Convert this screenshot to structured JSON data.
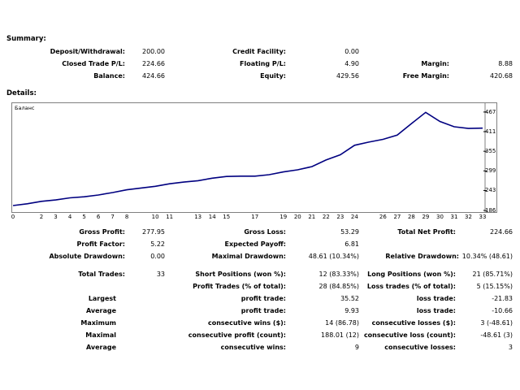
{
  "summary": {
    "title": "Summary:",
    "deposit_label": "Deposit/Withdrawal:",
    "deposit_value": "200.00",
    "credit_label": "Credit Facility:",
    "credit_value": "0.00",
    "closed_label": "Closed Trade P/L:",
    "closed_value": "224.66",
    "floating_label": "Floating P/L:",
    "floating_value": "4.90",
    "margin_label": "Margin:",
    "margin_value": "8.88",
    "balance_label": "Balance:",
    "balance_value": "424.66",
    "equity_label": "Equity:",
    "equity_value": "429.56",
    "free_margin_label": "Free Margin:",
    "free_margin_value": "420.68"
  },
  "details": {
    "title": "Details:"
  },
  "chart_data": {
    "type": "line",
    "title": "Баланс",
    "x": [
      0,
      1,
      2,
      3,
      4,
      5,
      6,
      7,
      8,
      9,
      10,
      11,
      12,
      13,
      14,
      15,
      16,
      17,
      18,
      19,
      20,
      21,
      22,
      23,
      24,
      25,
      26,
      27,
      28,
      29,
      30,
      31,
      32,
      33
    ],
    "y": [
      200,
      205,
      212,
      216,
      222,
      225,
      230,
      237,
      245,
      250,
      255,
      262,
      267,
      271,
      278,
      283,
      284,
      284,
      288,
      296,
      302,
      311,
      330,
      345,
      372,
      381,
      389,
      401,
      434,
      466,
      440,
      425,
      420,
      421
    ],
    "xticks": [
      0,
      2,
      3,
      4,
      5,
      6,
      7,
      8,
      10,
      11,
      13,
      14,
      15,
      17,
      19,
      20,
      21,
      22,
      23,
      24,
      26,
      27,
      28,
      29,
      30,
      31,
      32,
      33
    ],
    "yticks": [
      186,
      243,
      299,
      355,
      411,
      467
    ],
    "xlim": [
      0,
      33
    ],
    "ylim": [
      186,
      476
    ],
    "line_color": "#000080",
    "grid": false
  },
  "stats": {
    "gross_profit_label": "Gross Profit:",
    "gross_profit_value": "277.95",
    "gross_loss_label": "Gross Loss:",
    "gross_loss_value": "53.29",
    "total_net_label": "Total Net Profit:",
    "total_net_value": "224.66",
    "profit_factor_label": "Profit Factor:",
    "profit_factor_value": "5.22",
    "expected_payoff_label": "Expected Payoff:",
    "expected_payoff_value": "6.81",
    "abs_dd_label": "Absolute Drawdown:",
    "abs_dd_value": "0.00",
    "max_dd_label": "Maximal Drawdown:",
    "max_dd_value": "48.61 (10.34%)",
    "rel_dd_label": "Relative Drawdown:",
    "rel_dd_value": "10.34% (48.61)",
    "total_trades_label": "Total Trades:",
    "total_trades_value": "33",
    "short_label": "Short Positions (won %):",
    "short_value": "12 (83.33%)",
    "long_label": "Long Positions (won %):",
    "long_value": "21 (85.71%)",
    "profit_trades_label": "Profit Trades (% of total):",
    "profit_trades_value": "28 (84.85%)",
    "loss_trades_label": "Loss trades (% of total):",
    "loss_trades_value": "5 (15.15%)",
    "largest_label": "Largest",
    "largest_profit_label": "profit trade:",
    "largest_profit_value": "35.52",
    "largest_loss_label": "loss trade:",
    "largest_loss_value": "-21.83",
    "average_label": "Average",
    "average_profit_label": "profit trade:",
    "average_profit_value": "9.93",
    "average_loss_label": "loss trade:",
    "average_loss_value": "-10.66",
    "maximum_label": "Maximum",
    "max_cons_wins_label": "consecutive wins ($):",
    "max_cons_wins_value": "14 (86.78)",
    "max_cons_losses_label": "consecutive losses ($):",
    "max_cons_losses_value": "3 (-48.61)",
    "maximal_label": "Maximal",
    "maximal_cons_profit_label": "consecutive profit (count):",
    "maximal_cons_profit_value": "188.01 (12)",
    "maximal_cons_loss_label": "consecutive loss (count):",
    "maximal_cons_loss_value": "-48.61 (3)",
    "average2_label": "Average",
    "avg_cons_wins_label": "consecutive wins:",
    "avg_cons_wins_value": "9",
    "avg_cons_losses_label": "consecutive losses:",
    "avg_cons_losses_value": "3"
  }
}
